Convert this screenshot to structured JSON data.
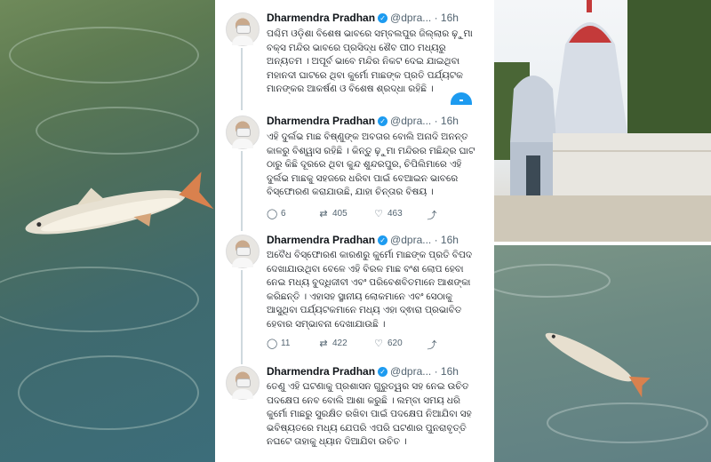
{
  "tweets": [
    {
      "name": "Dharmendra Pradhan",
      "handle": "@dpra...",
      "time": "· 16h",
      "text": "ପଶ୍ଚିମ ଓଡ଼ିଶା ବିଶେଷ ଭାବରେ ସମ୍ବଲପୁର ଜିଲ୍ଲାର ଢ଼ୁମା ବକ୍ସ ମନ୍ଦିର ଭାବରେ ପ୍ରସିଦ୍ଧ ଶୈବ ପୀଠ ମଧ୍ୟରୁ ଅନ୍ୟତମ । ଅପୂର୍ବ ଭାବେ ମନ୍ଦିର ନିକଟ ଦେଇ ଯାଇଥିବା ମହାନଦୀ ଘାଟରେ ଥିବା କୁର୍ମୋ ମାଛଙ୍କ ପ୍ରତି ପର୍ଯ୍ୟଟକ ମାନଙ୍କର ଆକର୍ଷଣ ଓ ବିଶେଷ ଶ୍ରଦ୍ଧା ରହିଛି ।",
      "replies": "",
      "retweets": "",
      "likes": ""
    },
    {
      "name": "Dharmendra Pradhan",
      "handle": "@dpra...",
      "time": "· 16h",
      "text": "ଏହି ଦୁର୍ଲଭ ମାଛ ବିଷ୍ଣୁଙ୍କ ଅବତାର ବୋଲି ଅନାଦି ଅନନ୍ତ କାଳରୁ ବିଶ୍ୱାସ ରହିଛି । କିନ୍ତୁ ଢ଼ୁମା ମନ୍ଦିରର ମଛିନ୍ଦ୍ର ଘାଟ ଠାରୁ କିଛି ଦୂରରେ ଥିବା କୁନ୍ଦ ଶୁନ୍ଦରପୁର, ଚିପିଲିମାରେ ଏହି ଦୁର୍ଲଭ ମାଛକୁ ସହଜରେ ଧରିବା ପାଇଁ ବେଆଇନ ଭାବରେ ବିସ୍ଫୋରଣ କରାଯାଉଛି, ଯାହା ଚିନ୍ତାର ବିଷୟ ।",
      "replies": "6",
      "retweets": "405",
      "likes": "463"
    },
    {
      "name": "Dharmendra Pradhan",
      "handle": "@dpra...",
      "time": "· 16h",
      "text": "ଅବୈଧ ବିସ୍ଫୋରଣ କାରଣରୁ କୁର୍ମୋ ମାଛଙ୍କ ପ୍ରତି ବିପଦ ଦେଖାଯାଉଥିବା ବେଳେ ଏହି ବିରଳ ମାଛ ବଂଶ ଲୋପ ହେବା ନେଇ ମଧ୍ୟ ବୁଦ୍ଧିଜୀବୀ ଏବଂ ପରିବେଶବିତମାନେ ଆଶଙ୍କା କରିଛନ୍ତି । ଏହାସହ ସ୍ଥାନୀୟ ଲୋକମାନେ ଏବଂ ସେଠାକୁ ଆସୁଥିବା ପର୍ଯ୍ୟଟକମାନେ ମଧ୍ୟ ଏହା ଦ୍ଵାରା ପ୍ରଭାବିତ ହେବାର ସମ୍ଭାବନା ଦେଖାଯାଉଛି ।",
      "replies": "11",
      "retweets": "422",
      "likes": "620"
    },
    {
      "name": "Dharmendra Pradhan",
      "handle": "@dpra...",
      "time": "· 16h",
      "text": "ତେଣୁ ଏହି ଘଟଣାକୁ ପ୍ରଶାସନ ଗୁରୁତ୍ୱର ସହ ନେଇ ଉଚିତ ପଦକ୍ଷେପ ନେବ ବୋଲି ଆଶା କରୁଛି । ଲମ୍ବା ସମୟ ଧରି କୁର୍ମୋ ମାଛରୁ ସୁରକ୍ଷିତ ରଖିବା ପାଇଁ ପଦକ୍ଷେପ ନିଆଯିବା ସହ ଭବିଷ୍ୟତରେ ମଧ୍ୟ ଯେପରି ଏପରି ଘଟଣାର ପୁନରାବୃତ୍ତି ନଘଟେ ତାହାକୁ ଧ୍ୟାନ ଦିଆଯିବା ଉଚିତ ।",
      "replies": "",
      "retweets": "",
      "likes": ""
    }
  ],
  "icons": {
    "reply": "speech-bubble-icon",
    "retweet": "retweet-icon",
    "like": "heart-icon",
    "share": "share-icon",
    "verified": "verified-badge-icon"
  },
  "colors": {
    "accent": "#1d9bf0",
    "text": "#0f1419",
    "muted": "#536471"
  }
}
